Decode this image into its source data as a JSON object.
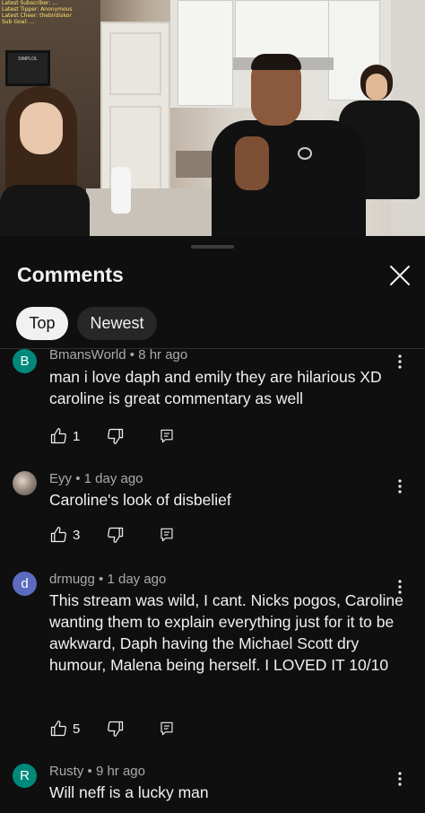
{
  "video": {
    "overlay_lines": [
      "Latest Subscriber: ...",
      "Latest Tipper: Anonymous",
      "Latest Cheer: thebirdiskor",
      "Sub Goal: ..."
    ],
    "tv_text": "SIMPLOL"
  },
  "sheet": {
    "title": "Comments",
    "filters": [
      {
        "label": "Top",
        "selected": true
      },
      {
        "label": "Newest",
        "selected": false
      }
    ]
  },
  "comments": [
    {
      "avatar_letter": "B",
      "avatar_color": "#00897b",
      "author": "BmansWorld",
      "time": "8 hr ago",
      "text": "man i love daph and emily they are hilarious XD caroline is great commentary as well",
      "likes": "1"
    },
    {
      "avatar_letter": "",
      "avatar_color": "#8a7f75",
      "author": "Eyy",
      "time": "1 day ago",
      "text": "Caroline's look of disbelief",
      "likes": "3"
    },
    {
      "avatar_letter": "d",
      "avatar_color": "#5c6bc0",
      "author": "drmugg",
      "time": "1 day ago",
      "text": "This stream was wild, I cant. Nicks pogos, Caroline wanting them to explain everything just for it to be awkward, Daph having the Michael Scott dry humour, Malena being herself. I LOVED IT 10/10",
      "likes": "5"
    },
    {
      "avatar_letter": "R",
      "avatar_color": "#00897b",
      "author": "Rusty",
      "time": "9 hr ago",
      "text": "Will neff is a lucky man",
      "likes": ""
    }
  ],
  "separator": "•",
  "icons": {
    "close": "close-icon",
    "more": "more-vertical-icon",
    "like": "thumbs-up-icon",
    "dislike": "thumbs-down-icon",
    "reply": "reply-comment-icon"
  }
}
